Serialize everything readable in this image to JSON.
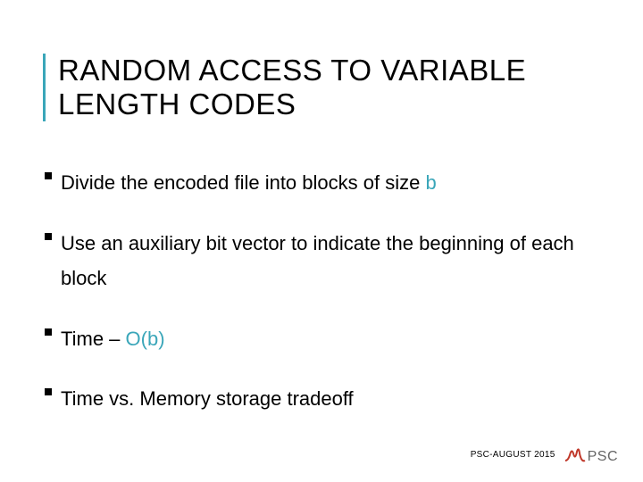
{
  "title": "RANDOM ACCESS TO VARIABLE LENGTH CODES",
  "bullets": [
    {
      "pre": "Divide the encoded file into blocks of size ",
      "accent": "b",
      "post": ""
    },
    {
      "pre": "Use an auxiliary bit vector to indicate the beginning of each block",
      "accent": "",
      "post": ""
    },
    {
      "pre": "Time – ",
      "accent": "O(b)",
      "post": ""
    },
    {
      "pre": "Time vs. Memory storage tradeoff",
      "accent": "",
      "post": ""
    }
  ],
  "footer": {
    "label": "PSC-AUGUST 2015",
    "logo_text": "PSC"
  }
}
